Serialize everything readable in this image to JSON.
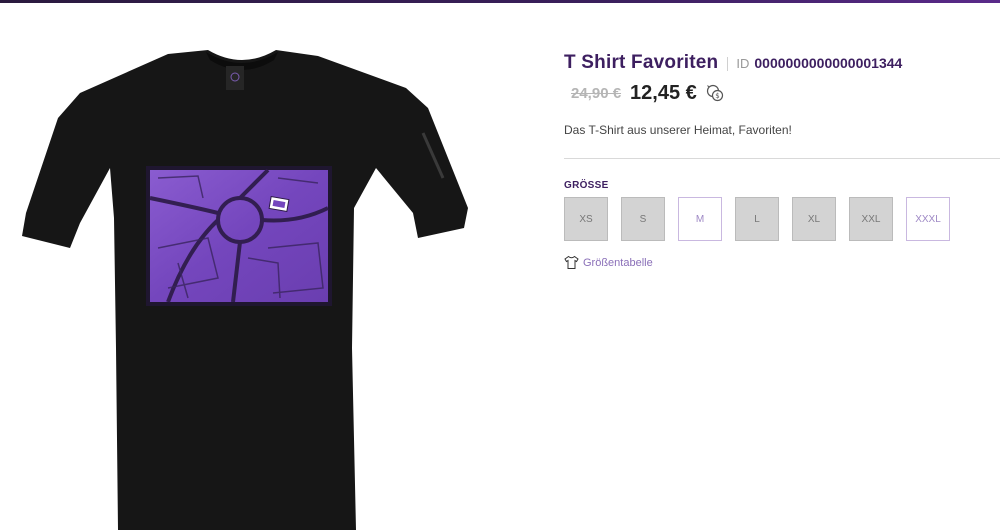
{
  "product": {
    "title": "T Shirt Favoriten",
    "id_label": "ID",
    "id_value": "0000000000000001344",
    "old_price": "24,90 €",
    "new_price": "12,45 €",
    "description": "Das T-Shirt aus unserer Heimat, Favoriten!"
  },
  "size_section": {
    "label": "GRÖSSE",
    "sizes": [
      {
        "label": "XS",
        "available": false
      },
      {
        "label": "S",
        "available": false
      },
      {
        "label": "M",
        "available": true
      },
      {
        "label": "L",
        "available": false
      },
      {
        "label": "XL",
        "available": false
      },
      {
        "label": "XXL",
        "available": false
      },
      {
        "label": "XXXL",
        "available": true
      }
    ],
    "size_chart_label": "Größentabelle"
  },
  "colors": {
    "brand": "#3d1f60",
    "print_purple": "#7a4fc0",
    "shirt": "#161616"
  },
  "icons": [
    "currency-exchange-icon",
    "shirt-icon"
  ]
}
